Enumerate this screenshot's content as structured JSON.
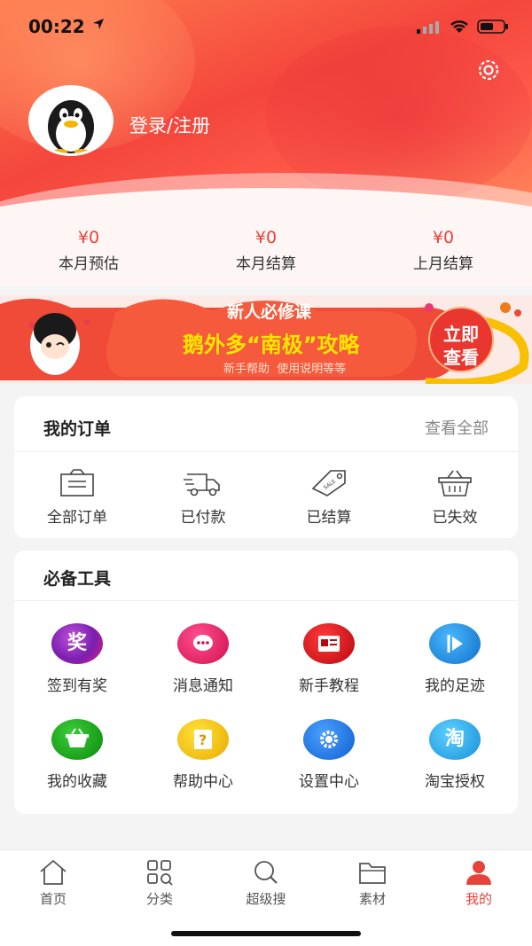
{
  "status_bar": {
    "time": "00:22"
  },
  "header": {
    "login_label": "登录/注册"
  },
  "stats": [
    {
      "value": "¥0",
      "label": "本月预估"
    },
    {
      "value": "¥0",
      "label": "本月结算"
    },
    {
      "value": "¥0",
      "label": "上月结算"
    }
  ],
  "banner": {
    "top": "新人必修课",
    "headline": "鹅外多“南极”攻略",
    "sub": "新手帮助  使用说明等等",
    "cta_line1": "立即",
    "cta_line2": "查看"
  },
  "orders": {
    "title": "我的订单",
    "view_all": "查看全部",
    "items": [
      {
        "label": "全部订单",
        "icon": "order-list-icon"
      },
      {
        "label": "已付款",
        "icon": "truck-icon"
      },
      {
        "label": "已结算",
        "icon": "sale-tag-icon"
      },
      {
        "label": "已失效",
        "icon": "basket-icon"
      }
    ]
  },
  "tools": {
    "title": "必备工具",
    "items": [
      {
        "label": "签到有奖",
        "icon": "reward-icon",
        "glyph": "奖",
        "color": "#8a2be2"
      },
      {
        "label": "消息通知",
        "icon": "message-icon",
        "glyph": "···",
        "color": "#e5195f"
      },
      {
        "label": "新手教程",
        "icon": "tutorial-icon",
        "glyph": "▤",
        "color": "#d8141d"
      },
      {
        "label": "我的足迹",
        "icon": "footprint-icon",
        "glyph": "▶",
        "color": "#1e90e0"
      },
      {
        "label": "我的收藏",
        "icon": "favorite-basket-icon",
        "glyph": "◡",
        "color": "#1aa31a"
      },
      {
        "label": "帮助中心",
        "icon": "help-icon",
        "glyph": "?",
        "color": "#f0c000"
      },
      {
        "label": "设置中心",
        "icon": "settings-icon",
        "glyph": "⚙",
        "color": "#1c7fe8"
      },
      {
        "label": "淘宝授权",
        "icon": "taobao-icon",
        "glyph": "淘",
        "color": "#22a8e8"
      }
    ]
  },
  "tabbar": {
    "accent": "#e8433b",
    "tabs": [
      {
        "label": "首页",
        "icon": "home-icon"
      },
      {
        "label": "分类",
        "icon": "category-icon"
      },
      {
        "label": "超级搜",
        "icon": "search-icon"
      },
      {
        "label": "素材",
        "icon": "folder-icon"
      },
      {
        "label": "我的",
        "icon": "profile-icon",
        "active": true
      }
    ]
  }
}
